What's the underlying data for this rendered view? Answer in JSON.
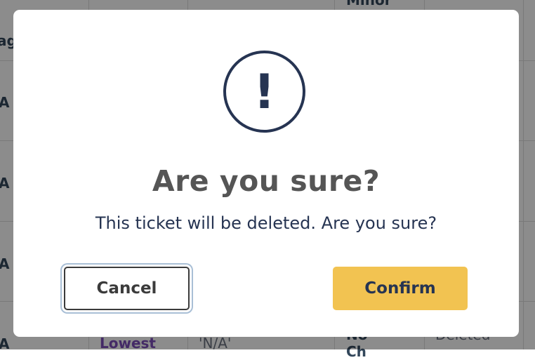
{
  "background_table": {
    "header_fragments": [
      "ag",
      "Minor"
    ],
    "row_fragments": [
      "A",
      "A",
      "A",
      "A"
    ],
    "last_row": {
      "priority": "Lowest",
      "value": "'N/A'",
      "partial": "No",
      "partial2": "Ch",
      "status": "Deleted"
    }
  },
  "dialog": {
    "icon": "exclamation-circle-icon",
    "icon_glyph": "!",
    "title": "Are you sure?",
    "message": "This ticket will be deleted. Are you sure?",
    "cancel_label": "Cancel",
    "confirm_label": "Confirm"
  },
  "colors": {
    "overlay": "rgba(0,0,0,0.45)",
    "icon": "#263452",
    "title": "#555555",
    "confirm_bg": "#f2c351",
    "cancel_focus_ring": "#a9bfd6",
    "priority_text": "#7c4dbb"
  }
}
